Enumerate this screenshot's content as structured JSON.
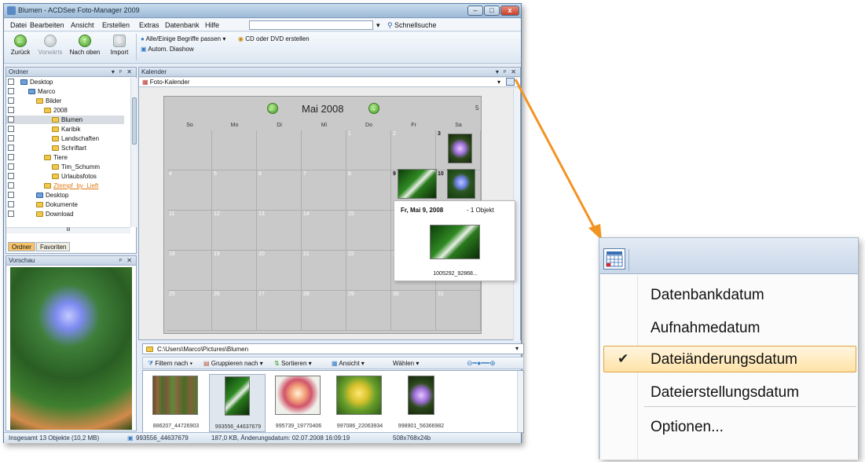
{
  "window": {
    "title": "Blumen - ACDSee Foto-Manager 2009"
  },
  "menu": {
    "items": [
      "Datei",
      "Bearbeiten",
      "Ansicht",
      "Erstellen",
      "Extras",
      "Datenbank",
      "Hilfe"
    ],
    "search_label": "Schnellsuche"
  },
  "toolbar": {
    "back": "Zurück",
    "forward": "Vorwärts",
    "up": "Nach oben",
    "import": "Import",
    "tags": "Alle/Einige Begriffe passen",
    "cd": "CD oder DVD erstellen",
    "slideshow": "Autom. Diashow"
  },
  "folders": {
    "title": "Ordner",
    "items": [
      "Desktop",
      "Marco",
      "Bilder",
      "2008",
      "Blumen",
      "Karibik",
      "Landschaften",
      "Schriftart",
      "Tiere",
      "Tim_Schumm",
      "Urlaubsfotos",
      "Ztempf_by_Lieft",
      "Desktop",
      "Dokumente",
      "Download"
    ],
    "scroll_label": "III",
    "tabs": [
      "Ordner",
      "Favoriten"
    ]
  },
  "preview": {
    "title": "Vorschau"
  },
  "calendar": {
    "pane_title": "Kalender",
    "mode": "Foto-Kalender",
    "month": "Mai 2008",
    "week_label": "5",
    "weekdays": [
      "So",
      "Mo",
      "Di",
      "Mi",
      "Do",
      "Fr",
      "Sa"
    ],
    "weeks": [
      [
        "",
        "",
        "",
        "",
        "1",
        "2",
        "3"
      ],
      [
        "4",
        "5",
        "6",
        "7",
        "8",
        "9",
        "10"
      ],
      [
        "11",
        "12",
        "13",
        "14",
        "15",
        "16",
        "17"
      ],
      [
        "18",
        "19",
        "20",
        "21",
        "22",
        "23",
        "24"
      ],
      [
        "25",
        "26",
        "27",
        "28",
        "29",
        "30",
        "31"
      ]
    ],
    "popup": {
      "date": "Fr, Mai 9, 2008",
      "count": "- 1 Objekt",
      "filename": "1005292_92868..."
    }
  },
  "filelist": {
    "path": "C:\\Users\\Marco\\Pictures\\Blumen",
    "filter": "Filtern nach",
    "group": "Gruppieren nach",
    "sort": "Sortieren",
    "view": "Ansicht",
    "select": "Wählen",
    "thumbnails": [
      "886207_44726903",
      "993556_44637679",
      "995739_19770406",
      "997086_22063934",
      "998901_56366982"
    ]
  },
  "status": {
    "count": "Insgesamt 13 Objekte (10,2 MB)",
    "file": "993556_44637679",
    "info": "187,0 KB, Änderungsdatum: 02.07.2008 16:09:19",
    "dims": "508x768x24b"
  },
  "zoom_menu": {
    "items": [
      "Datenbankdatum",
      "Aufnahmedatum",
      "Dateiänderungsdatum",
      "Dateierstellungsdatum",
      "Optionen..."
    ],
    "selected_index": 2
  },
  "colors": {
    "accent_arrow": "#f29422",
    "selection_border": "#e0a240",
    "calendar_bg": "#c9c9c9"
  }
}
